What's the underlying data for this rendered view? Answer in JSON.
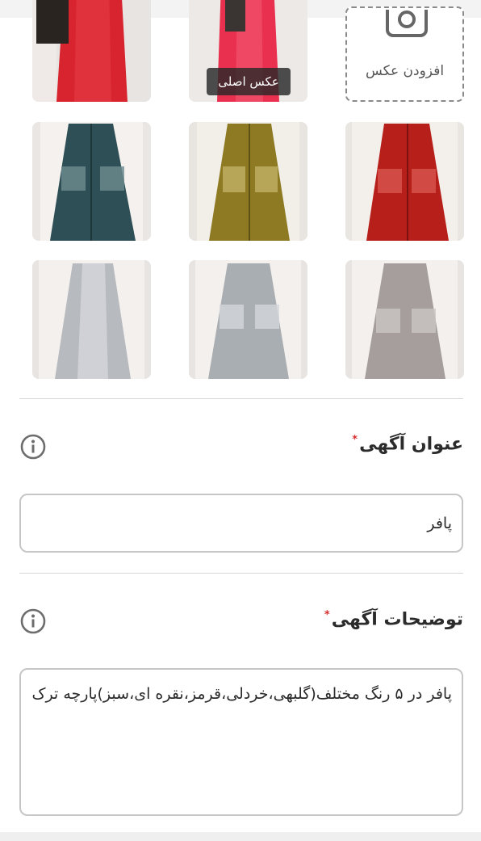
{
  "photos": {
    "main_badge": "عکس اصلی",
    "add_photo_label": "افزودن عکس",
    "add_photo_icon": "camera-icon",
    "items": [
      {
        "color": "red",
        "hex": "#d8242e"
      },
      {
        "color": "pink",
        "hex": "#e9304e"
      },
      {
        "color": "teal",
        "hex": "#2d4f55"
      },
      {
        "color": "mustard",
        "hex": "#8d7a22"
      },
      {
        "color": "red",
        "hex": "#b61f1a"
      },
      {
        "color": "silver",
        "hex": "#b7babe"
      },
      {
        "color": "silver",
        "hex": "#a9aeb2"
      },
      {
        "color": "gray",
        "hex": "#a59e9c"
      }
    ]
  },
  "title_field": {
    "label": "عنوان آگهی",
    "required_mark": "*",
    "value": "پافر",
    "info_icon": "info-icon"
  },
  "description_field": {
    "label": "توضیحات آگهی",
    "required_mark": "*",
    "value": "پافر در ۵ رنگ مختلف(گلبهی،خردلی،قرمز،نقره ای،سبز)پارچه ترک",
    "info_icon": "info-icon"
  },
  "theme": {
    "required_color": "#d32f2f",
    "border_color": "#c6c6c6"
  }
}
